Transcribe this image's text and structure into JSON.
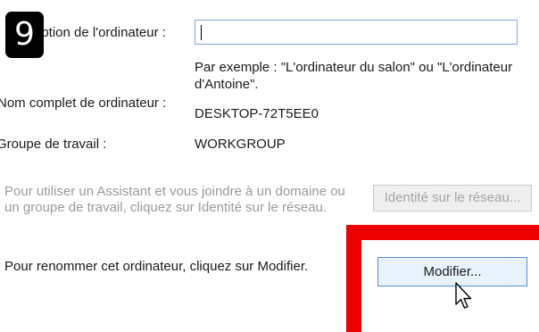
{
  "step_badge": "9",
  "description": {
    "label": "ription de l'ordinateur :",
    "value": "",
    "hint": "Par exemple : \"L'ordinateur du salon\" ou \"L'ordinateur d'Antoine\"."
  },
  "full_name": {
    "label": "Nom complet de ordinateur :",
    "value": "DESKTOP-72T5EE0"
  },
  "workgroup": {
    "label": "Groupe de travail :",
    "value": "WORKGROUP"
  },
  "network_id": {
    "text": "Pour utiliser un Assistant et vous joindre à un domaine ou un groupe de travail, cliquez sur Identité sur le réseau.",
    "button_label": "Identité sur le réseau..."
  },
  "rename": {
    "text": "Pour renommer cet ordinateur, cliquez sur Modifier.",
    "button_label": "Modifier..."
  },
  "highlight_color": "#ec0000",
  "cursor_icon": "arrow-pointer-icon"
}
